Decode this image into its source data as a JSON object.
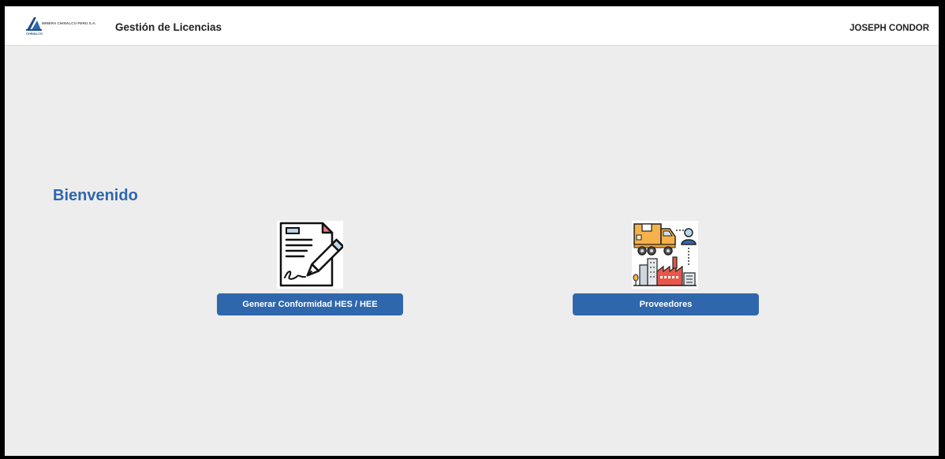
{
  "header": {
    "logo_company": "MINERA CHINALCO PERU S.A.",
    "logo_sub": "CHINALCO",
    "app_title": "Gestión de Licencias",
    "user_name": "JOSEPH CONDOR"
  },
  "main": {
    "welcome": "Bienvenido",
    "cards": [
      {
        "icon": "document-sign-icon",
        "button_label": "Generar Conformidad HES / HEE"
      },
      {
        "icon": "supplier-logistics-icon",
        "button_label": "Proveedores"
      }
    ]
  },
  "colors": {
    "accent": "#2f67ad",
    "background": "#ededed",
    "header": "#ffffff"
  }
}
